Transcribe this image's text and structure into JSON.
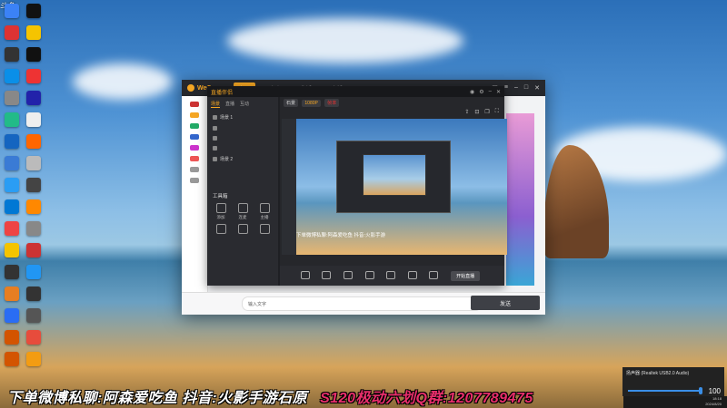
{
  "desktop": {
    "top_peek_text": "斗鱼",
    "icons": [
      {
        "label": "",
        "color": "#3b82f6"
      },
      {
        "label": "",
        "color": "#111"
      },
      {
        "label": "",
        "color": "#d33"
      },
      {
        "label": "",
        "color": "#f5c400"
      },
      {
        "label": "",
        "color": "#333"
      },
      {
        "label": "",
        "color": "#111"
      },
      {
        "label": "",
        "color": "#0a8fe8"
      },
      {
        "label": "",
        "color": "#e33"
      },
      {
        "label": "",
        "color": "#888"
      },
      {
        "label": "",
        "color": "#22a"
      },
      {
        "label": "",
        "color": "#2b8"
      },
      {
        "label": "",
        "color": "#eee"
      },
      {
        "label": "",
        "color": "#1565c0"
      },
      {
        "label": "",
        "color": "#f60"
      },
      {
        "label": "",
        "color": "#3a7bd5"
      },
      {
        "label": "",
        "color": "#bbb"
      },
      {
        "label": "",
        "color": "#2a9df4"
      },
      {
        "label": "",
        "color": "#444"
      },
      {
        "label": "",
        "color": "#0078d4"
      },
      {
        "label": "",
        "color": "#f80"
      },
      {
        "label": "",
        "color": "#e44"
      },
      {
        "label": "",
        "color": "#888"
      },
      {
        "label": "",
        "color": "#f5c400"
      },
      {
        "label": "",
        "color": "#c33"
      },
      {
        "label": "",
        "color": "#333"
      },
      {
        "label": "",
        "color": "#2196f3"
      },
      {
        "label": "",
        "color": "#e67e22"
      },
      {
        "label": "",
        "color": "#333"
      },
      {
        "label": "",
        "color": "#2a6df4"
      },
      {
        "label": "",
        "color": "#555"
      },
      {
        "label": "",
        "color": "#d35400"
      },
      {
        "label": "",
        "color": "#e74c3c"
      },
      {
        "label": "",
        "color": "#d35400"
      },
      {
        "label": "",
        "color": "#f39c12"
      }
    ]
  },
  "window": {
    "app_name": "WeGame",
    "tabs": [
      "主页",
      "商店",
      "生活",
      "直播"
    ],
    "active_tab_index": 0
  },
  "inner_app": {
    "title": "直播伴侣",
    "side_tabs": [
      "场景",
      "直播",
      "互动"
    ],
    "scenes": [
      "场景 1",
      "",
      "",
      "",
      "场景 2"
    ],
    "tools_heading": "工具箱",
    "tools": [
      "添加",
      "连麦",
      "主播",
      "",
      ""
    ],
    "footer": "",
    "preview_badges": [
      "石景",
      "1080P",
      "帧率"
    ],
    "marquee_white": "下单微博私聊:阿森爱吃鱼 抖音:火影手游",
    "marquee_pink": "",
    "controls": [
      "",
      "",
      "",
      "",
      "",
      "",
      ""
    ],
    "go_live": "开始直播"
  },
  "bottom_bar": {
    "chat_left": "输入文字",
    "chat_right": "",
    "send_label": "发送"
  },
  "banner": {
    "white": "下单微博私聊:阿森爱吃鱼 抖音:火影手游石原",
    "pink": "S120极动六划Q群:1207789475"
  },
  "audio_popup": {
    "device": "扬声器 (Realtek USB2.0 Audio)",
    "volume": 100,
    "time": "18:18",
    "date": "2024/8/20"
  }
}
